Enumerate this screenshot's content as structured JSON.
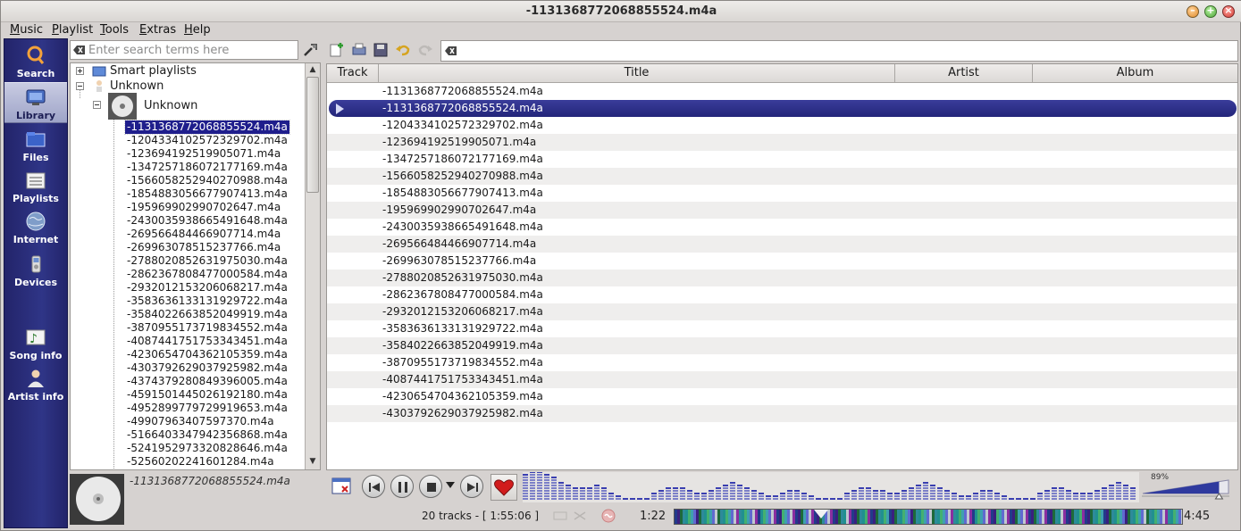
{
  "window": {
    "title": "-1131368772068855524.m4a"
  },
  "menu": [
    "Music",
    "Playlist",
    "Tools",
    "Extras",
    "Help"
  ],
  "sidebar": [
    {
      "label": "Search",
      "icon": "search-icon"
    },
    {
      "label": "Library",
      "icon": "library-icon",
      "active": true
    },
    {
      "label": "Files",
      "icon": "files-icon"
    },
    {
      "label": "Playlists",
      "icon": "playlists-icon"
    },
    {
      "label": "Internet",
      "icon": "internet-icon"
    },
    {
      "label": "Devices",
      "icon": "devices-icon"
    },
    {
      "label": "Song info",
      "icon": "song-info-icon"
    },
    {
      "label": "Artist info",
      "icon": "artist-info-icon"
    }
  ],
  "library": {
    "search_placeholder": "Enter search terms here",
    "smart_playlists": "Smart playlists",
    "artist": "Unknown",
    "album": "Unknown",
    "tracks": [
      "-1131368772068855524.m4a",
      "-1204334102572329702.m4a",
      "-123694192519905071.m4a",
      "-1347257186072177169.m4a",
      "-1566058252940270988.m4a",
      "-1854883056677907413.m4a",
      "-195969902990702647.m4a",
      "-2430035938665491648.m4a",
      "-269566484466907714.m4a",
      "-269963078515237766.m4a",
      "-2788020852631975030.m4a",
      "-2862367808477000584.m4a",
      "-2932012153206068217.m4a",
      "-3583636133131929722.m4a",
      "-3584022663852049919.m4a",
      "-3870955173719834552.m4a",
      "-4087441751753343451.m4a",
      "-4230654704362105359.m4a",
      "-4303792629037925982.m4a",
      "-4374379280849396005.m4a",
      "-4591501445026192180.m4a",
      "-4952899779729919653.m4a",
      "-49907963407597370.m4a",
      "-5166403347942356868.m4a",
      "-5241952973320828646.m4a",
      "-52560202241601284.m4a"
    ],
    "selected_index": 0
  },
  "now_playing": {
    "title": "-1131368772068855524.m4a"
  },
  "playlist": {
    "filter_value": "",
    "columns": [
      "Track",
      "Title",
      "Artist",
      "Album"
    ],
    "rows": [
      "-1131368772068855524.m4a",
      "-1131368772068855524.m4a",
      "-1204334102572329702.m4a",
      "-123694192519905071.m4a",
      "-1347257186072177169.m4a",
      "-1566058252940270988.m4a",
      "-1854883056677907413.m4a",
      "-195969902990702647.m4a",
      "-2430035938665491648.m4a",
      "-269566484466907714.m4a",
      "-269963078515237766.m4a",
      "-2788020852631975030.m4a",
      "-2862367808477000584.m4a",
      "-2932012153206068217.m4a",
      "-3583636133131929722.m4a",
      "-3584022663852049919.m4a",
      "-3870955173719834552.m4a",
      "-4087441751753343451.m4a",
      "-4230654704362105359.m4a",
      "-4303792629037925982.m4a"
    ],
    "current_index": 1
  },
  "player": {
    "volume_label": "89%",
    "volume": 0.89,
    "status": "20 tracks - [ 1:55:06 ]",
    "elapsed": "1:22",
    "total": "4:45",
    "progress": 0.288,
    "colors": {
      "accent": "#23257a",
      "love": "#d11c1c"
    }
  }
}
